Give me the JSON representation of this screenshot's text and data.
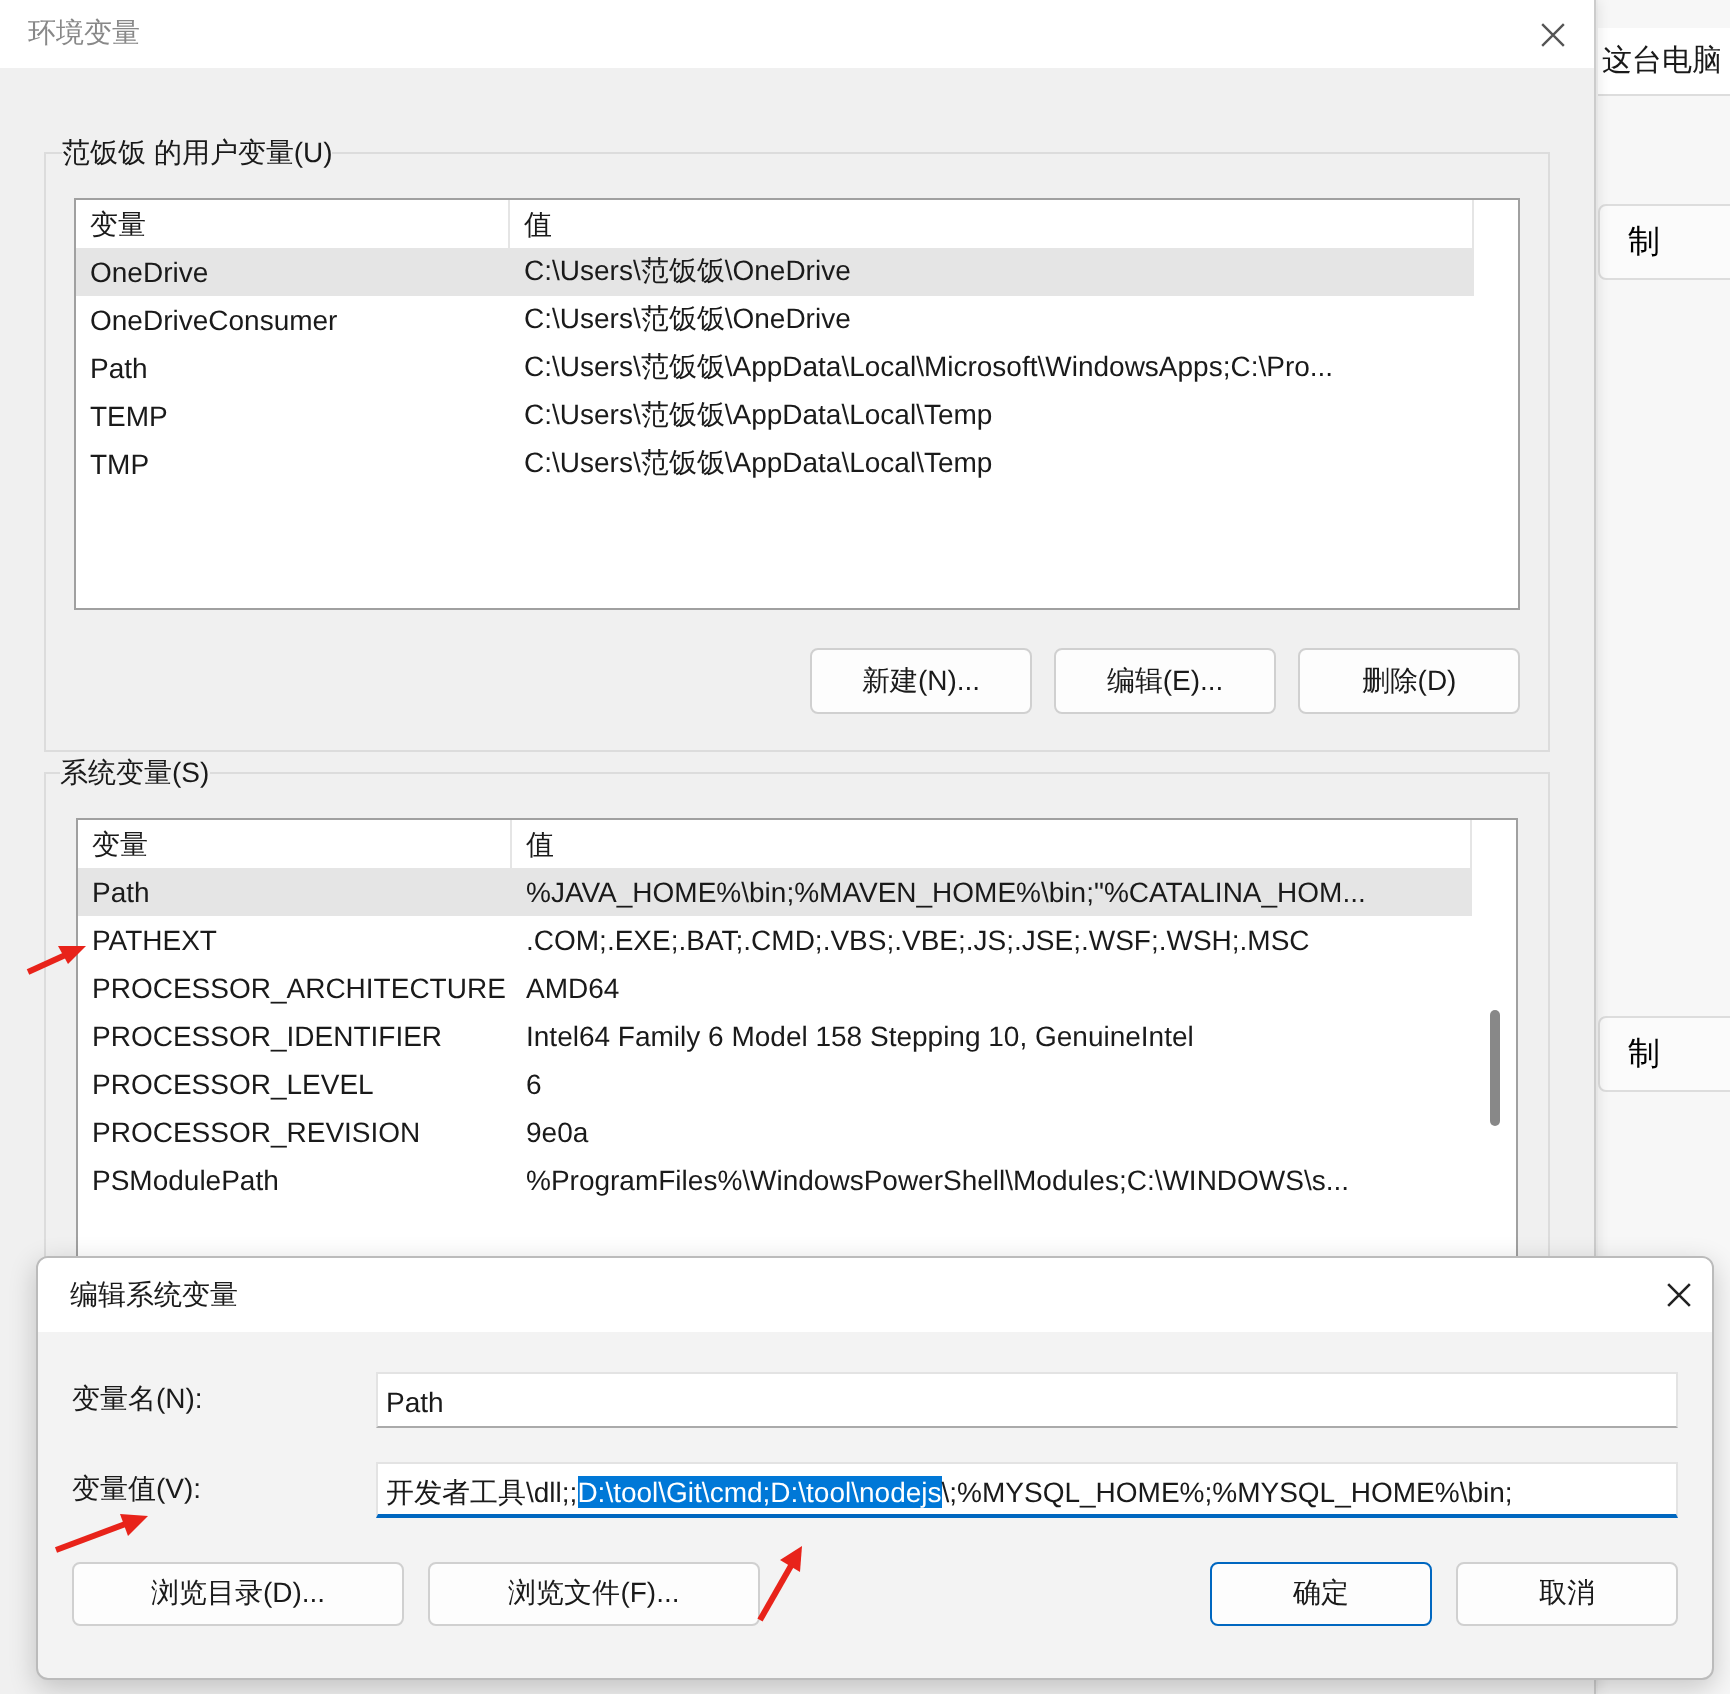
{
  "background_window": {
    "title_fragment": "这台电脑",
    "buttons": [
      "制",
      "制"
    ]
  },
  "window": {
    "title": "环境变量"
  },
  "user_variables": {
    "label": "范饭饭 的用户变量(U)",
    "columns": [
      "变量",
      "值"
    ],
    "rows": [
      {
        "name": "OneDrive",
        "value": "C:\\Users\\范饭饭\\OneDrive",
        "selected": true
      },
      {
        "name": "OneDriveConsumer",
        "value": "C:\\Users\\范饭饭\\OneDrive",
        "selected": false
      },
      {
        "name": "Path",
        "value": "C:\\Users\\范饭饭\\AppData\\Local\\Microsoft\\WindowsApps;C:\\Pro...",
        "selected": false
      },
      {
        "name": "TEMP",
        "value": "C:\\Users\\范饭饭\\AppData\\Local\\Temp",
        "selected": false
      },
      {
        "name": "TMP",
        "value": "C:\\Users\\范饭饭\\AppData\\Local\\Temp",
        "selected": false
      }
    ],
    "buttons": [
      "新建(N)...",
      "编辑(E)...",
      "删除(D)"
    ]
  },
  "system_variables": {
    "label": "系统变量(S)",
    "columns": [
      "变量",
      "值"
    ],
    "rows": [
      {
        "name": "Path",
        "value": "%JAVA_HOME%\\bin;%MAVEN_HOME%\\bin;\"%CATALINA_HOM...",
        "selected": true
      },
      {
        "name": "PATHEXT",
        "value": ".COM;.EXE;.BAT;.CMD;.VBS;.VBE;.JS;.JSE;.WSF;.WSH;.MSC",
        "selected": false
      },
      {
        "name": "PROCESSOR_ARCHITECTURE",
        "value": "AMD64",
        "selected": false
      },
      {
        "name": "PROCESSOR_IDENTIFIER",
        "value": "Intel64 Family 6 Model 158 Stepping 10, GenuineIntel",
        "selected": false
      },
      {
        "name": "PROCESSOR_LEVEL",
        "value": "6",
        "selected": false
      },
      {
        "name": "PROCESSOR_REVISION",
        "value": "9e0a",
        "selected": false
      },
      {
        "name": "PSModulePath",
        "value": "%ProgramFiles%\\WindowsPowerShell\\Modules;C:\\WINDOWS\\s...",
        "selected": false
      }
    ]
  },
  "edit_dialog": {
    "title": "编辑系统变量",
    "name_label": "变量名(N):",
    "name_value": "Path",
    "value_label": "变量值(V):",
    "value_parts": [
      {
        "text": "开发者工具\\dll;;",
        "selected": false
      },
      {
        "text": "D:\\tool\\Git\\cmd;D:\\tool\\nodejs",
        "selected": true
      },
      {
        "text": "\\;%MYSQL_HOME%;%MYSQL_HOME%\\bin;",
        "selected": false
      }
    ],
    "buttons": [
      {
        "label": "浏览目录(D)...",
        "default": false
      },
      {
        "label": "浏览文件(F)...",
        "default": false
      },
      {
        "label": "确定",
        "default": true
      },
      {
        "label": "取消",
        "default": false
      }
    ]
  }
}
